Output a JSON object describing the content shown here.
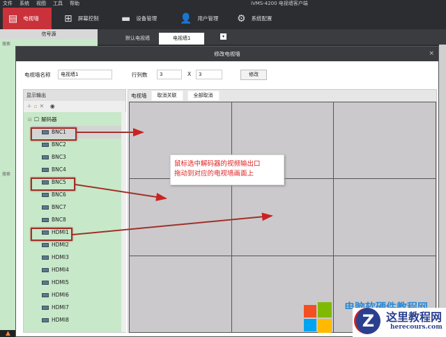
{
  "menu": [
    "文件",
    "系统",
    "视图",
    "工具",
    "帮助"
  ],
  "app_title": "iVMS-4200 电视墙客户端",
  "toolbar": [
    {
      "label": "电视墙",
      "icon": "tv-wall-icon",
      "active": true
    },
    {
      "label": "屏幕控制",
      "icon": "grid-icon"
    },
    {
      "label": "设备管理",
      "icon": "device-icon"
    },
    {
      "label": "用户管理",
      "icon": "user-icon"
    },
    {
      "label": "系统配置",
      "icon": "gear-icon"
    }
  ],
  "source_panel": {
    "title": "信号源",
    "search": "搜索"
  },
  "tabs": [
    "默认电视墙",
    "电视墙1"
  ],
  "dialog": {
    "title": "修改电视墙",
    "close": "×",
    "name_label": "电视墙名称",
    "name_value": "电视墙1",
    "rc_label": "行列数",
    "rows": "3",
    "x": "X",
    "cols": "3",
    "modify": "修改",
    "output_title": "显示输出",
    "tree_root": "解码器",
    "outputs": [
      "BNC1",
      "BNC2",
      "BNC3",
      "BNC4",
      "BNC5",
      "BNC6",
      "BNC7",
      "BNC8",
      "HDMI1",
      "HDMI2",
      "HDMI3",
      "HDMI4",
      "HDMI5",
      "HDMI6",
      "HDMI7",
      "HDMI8"
    ],
    "wall_label": "电视墙",
    "unlink": "取消关联",
    "cancel_all": "全部取消",
    "grid": {
      "rows": 3,
      "cols": 3
    }
  },
  "callout": [
    "鼠标选中解码器的视频输出口",
    "拖动到对应的电视墙画面上"
  ],
  "watermark": {
    "line1": "电脑软硬件教程网",
    "brand": "这里教程网",
    "url": "herecours.com"
  }
}
